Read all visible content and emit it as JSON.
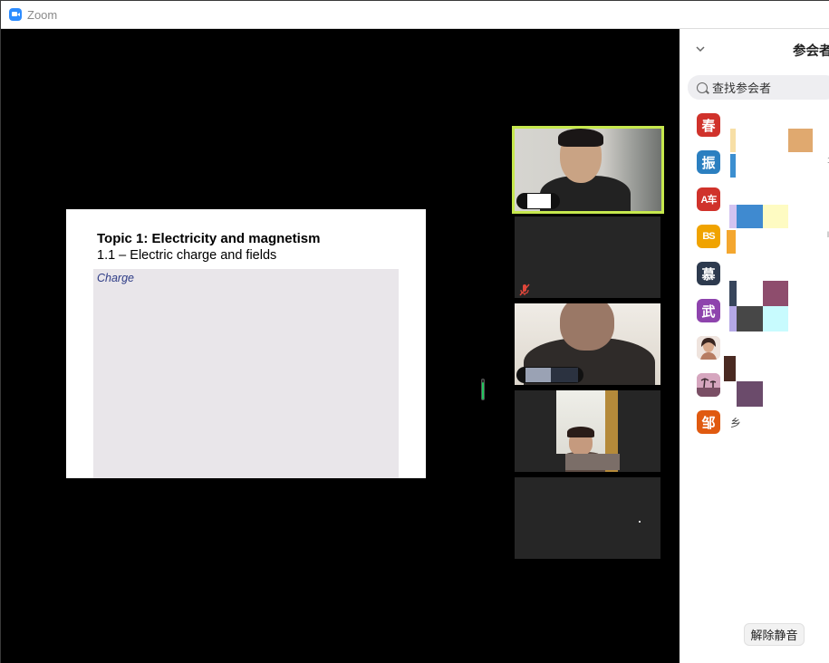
{
  "window": {
    "title": "Zoom"
  },
  "slide": {
    "title": "Topic 1: Electricity and magnetism",
    "subtitle": "1.1 – Electric charge and fields",
    "panel_label": "Charge"
  },
  "audio_meter": {
    "level_fraction": 0.85,
    "color": "#22c55e"
  },
  "video_tiles": [
    {
      "id": "tile-1",
      "active": true,
      "has_video": true
    },
    {
      "id": "tile-2",
      "active": false,
      "has_video": false,
      "muted": true
    },
    {
      "id": "tile-3",
      "active": false,
      "has_video": true
    },
    {
      "id": "tile-4",
      "active": false,
      "has_video": true
    },
    {
      "id": "tile-5",
      "active": false,
      "has_video": false
    }
  ],
  "participants_panel": {
    "title": "参会者",
    "search_placeholder": "查找参会者",
    "participants": [
      {
        "avatar_text": "春",
        "avatar_color": "#d0322b"
      },
      {
        "avatar_text": "振",
        "avatar_color": "#2b7fc0"
      },
      {
        "avatar_text": "A车",
        "avatar_color": "#d0322b"
      },
      {
        "avatar_text": "BS",
        "avatar_color": "#f0a300"
      },
      {
        "avatar_text": "慕",
        "avatar_color": "#2d3a4e"
      },
      {
        "avatar_text": "武",
        "avatar_color": "#8e44ad"
      },
      {
        "avatar_text": "",
        "avatar_color": "#e8cfc4",
        "photo": true
      },
      {
        "avatar_text": "",
        "avatar_color": "#c69bb0",
        "photo": true
      },
      {
        "avatar_text": "邹",
        "avatar_color": "#e05a10"
      }
    ],
    "partial_name": "乡",
    "unmute_button": "解除静音"
  }
}
